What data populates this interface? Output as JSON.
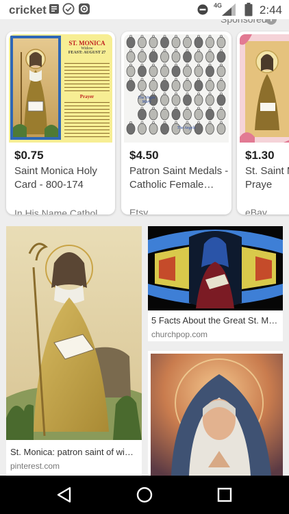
{
  "status_bar": {
    "carrier": "cricket",
    "network_label": "4G",
    "time": "2:44"
  },
  "shopping": {
    "sponsored_label": "Sponsored",
    "cards": [
      {
        "price": "$0.75",
        "title": "Saint Monica Holy Card - 800-174",
        "merchant": "In His Name Cathol…"
      },
      {
        "price": "$4.50",
        "title": "Patron Saint Medals - Catholic Female…",
        "merchant": "Etsy"
      },
      {
        "price": "$1.30",
        "title": "St. Saint M With Praye",
        "merchant": "eBay"
      }
    ],
    "holy_card_text": {
      "heading": "ST. MONICA",
      "subheading": "Widow",
      "feast": "FEAST: AUGUST 27",
      "prayer_label": "Prayer"
    },
    "medals_text": {
      "label_left": "The Virgin Mary",
      "label_right": "The Angels"
    }
  },
  "image_results": [
    {
      "caption": "St. Monica: patron saint of wi…",
      "source": "pinterest.com"
    },
    {
      "caption": "5 Facts About the Great St. M…",
      "source": "churchpop.com"
    },
    {
      "caption": "",
      "source": ""
    }
  ],
  "colors": {
    "background": "#eeeeee",
    "card": "#ffffff",
    "nav_bar": "#000000"
  }
}
